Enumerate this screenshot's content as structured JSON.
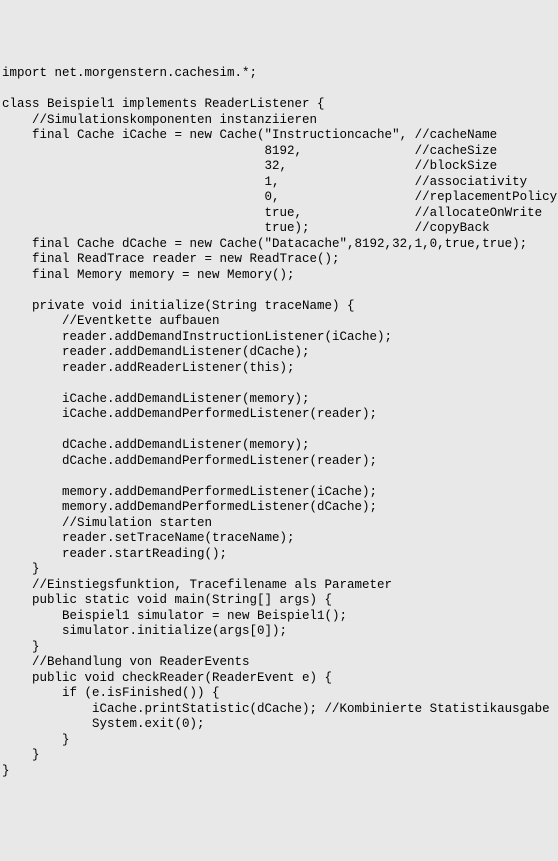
{
  "lines": [
    "import net.morgenstern.cachesim.*;",
    "",
    "class Beispiel1 implements ReaderListener {",
    "    //Simulationskomponenten instanziieren",
    "    final Cache iCache = new Cache(\"Instructioncache\", //cacheName",
    "                                   8192,               //cacheSize",
    "                                   32,                 //blockSize",
    "                                   1,                  //associativity",
    "                                   0,                  //replacementPolicy",
    "                                   true,               //allocateOnWrite",
    "                                   true);              //copyBack",
    "    final Cache dCache = new Cache(\"Datacache\",8192,32,1,0,true,true);",
    "    final ReadTrace reader = new ReadTrace();",
    "    final Memory memory = new Memory();",
    "",
    "    private void initialize(String traceName) {",
    "        //Eventkette aufbauen",
    "        reader.addDemandInstructionListener(iCache);",
    "        reader.addDemandListener(dCache);",
    "        reader.addReaderListener(this);",
    "",
    "        iCache.addDemandListener(memory);",
    "        iCache.addDemandPerformedListener(reader);",
    "",
    "        dCache.addDemandListener(memory);",
    "        dCache.addDemandPerformedListener(reader);",
    "",
    "        memory.addDemandPerformedListener(iCache);",
    "        memory.addDemandPerformedListener(dCache);",
    "        //Simulation starten",
    "        reader.setTraceName(traceName);",
    "        reader.startReading();",
    "    }",
    "    //Einstiegsfunktion, Tracefilename als Parameter",
    "    public static void main(String[] args) {",
    "        Beispiel1 simulator = new Beispiel1();",
    "        simulator.initialize(args[0]);",
    "    }",
    "    //Behandlung von ReaderEvents",
    "    public void checkReader(ReaderEvent e) {",
    "        if (e.isFinished()) {",
    "            iCache.printStatistic(dCache); //Kombinierte Statistikausgabe",
    "            System.exit(0);",
    "        }",
    "    }",
    "}"
  ]
}
